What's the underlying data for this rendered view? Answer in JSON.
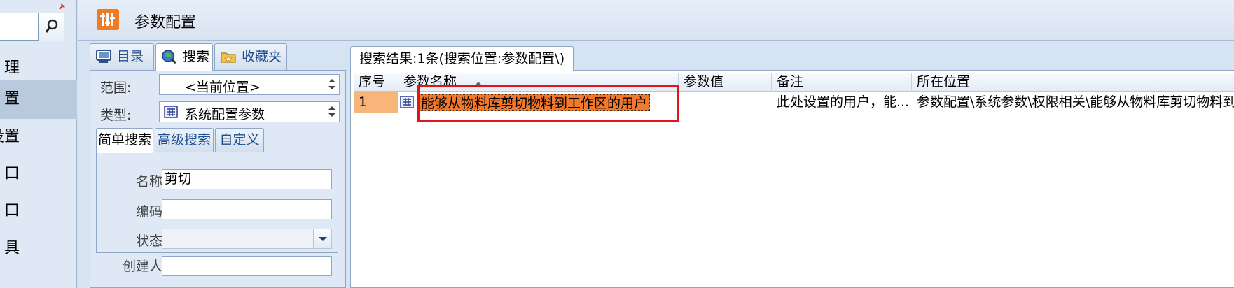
{
  "nav": {
    "items": [
      {
        "label": "理",
        "active": false
      },
      {
        "label": "置",
        "active": true
      },
      {
        "label": "设置",
        "active": false
      },
      {
        "label": "口",
        "active": false
      },
      {
        "label": "口",
        "active": false
      },
      {
        "label": "具",
        "active": false
      }
    ]
  },
  "title": "参数配置",
  "left_panel": {
    "tabs": [
      "目录",
      "搜索",
      "收藏夹"
    ],
    "active_tab": "搜索",
    "scope_label": "范围:",
    "scope_value": "<当前位置>",
    "type_label": "类型:",
    "type_value": "系统配置参数",
    "search_tabs": [
      "简单搜索",
      "高级搜索",
      "自定义"
    ],
    "active_search_tab": "简单搜索",
    "fields": {
      "name_label": "名称",
      "name_value": "剪切",
      "code_label": "编码",
      "code_value": "",
      "status_label": "状态",
      "status_value": "",
      "creator_label": "创建人"
    }
  },
  "result_panel": {
    "tab_label": "搜索结果:1条(搜索位置:参数配置\\)",
    "columns": [
      "序号",
      "参数名称",
      "参数值",
      "备注",
      "所在位置"
    ],
    "rows": [
      {
        "seq": "1",
        "name": "能够从物料库剪切物料到工作区的用户",
        "value": "",
        "remark": "此处设置的用户，能...",
        "location": "参数配置\\系统参数\\权限相关\\能够从物料库剪切物料到工作区的用户"
      }
    ]
  },
  "colors": {
    "accent_orange": "#f07b25",
    "selection_orange": "#f2792c",
    "highlight_red": "#e0151c",
    "frame_blue": "#8fa6c6"
  }
}
